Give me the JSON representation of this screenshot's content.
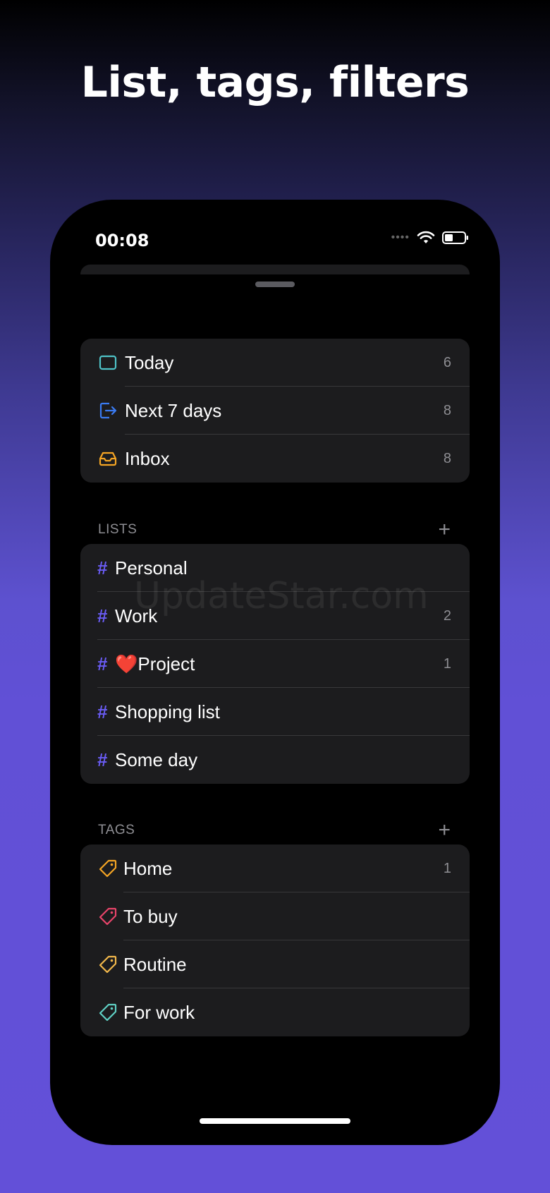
{
  "headline": "List, tags, filters",
  "status_bar": {
    "time": "00:08"
  },
  "smart_lists": [
    {
      "label": "Today",
      "count": "6",
      "icon": "calendar-today-icon",
      "color": "#4fc3c8"
    },
    {
      "label": "Next 7 days",
      "count": "8",
      "icon": "arrow-right-box-icon",
      "color": "#3a7bf3"
    },
    {
      "label": "Inbox",
      "count": "8",
      "icon": "inbox-tray-icon",
      "color": "#f5a524"
    }
  ],
  "lists_section": {
    "title": "LISTS",
    "items": [
      {
        "label": "Personal",
        "count": ""
      },
      {
        "label": "Work",
        "count": "2"
      },
      {
        "label": "❤️Project",
        "count": "1"
      },
      {
        "label": "Shopping list",
        "count": ""
      },
      {
        "label": "Some day",
        "count": ""
      }
    ]
  },
  "tags_section": {
    "title": "TAGS",
    "items": [
      {
        "label": "Home",
        "count": "1",
        "color": "#f5a524"
      },
      {
        "label": "To buy",
        "count": "",
        "color": "#e8446a"
      },
      {
        "label": "Routine",
        "count": "",
        "color": "#f2b84b"
      },
      {
        "label": "For work",
        "count": "",
        "color": "#5fd0c4"
      }
    ]
  },
  "watermark": "UpdateStar.com",
  "colors": {
    "accent": "#6a5cf5",
    "card": "#1c1c1e",
    "secondary_text": "#8e8e93"
  }
}
